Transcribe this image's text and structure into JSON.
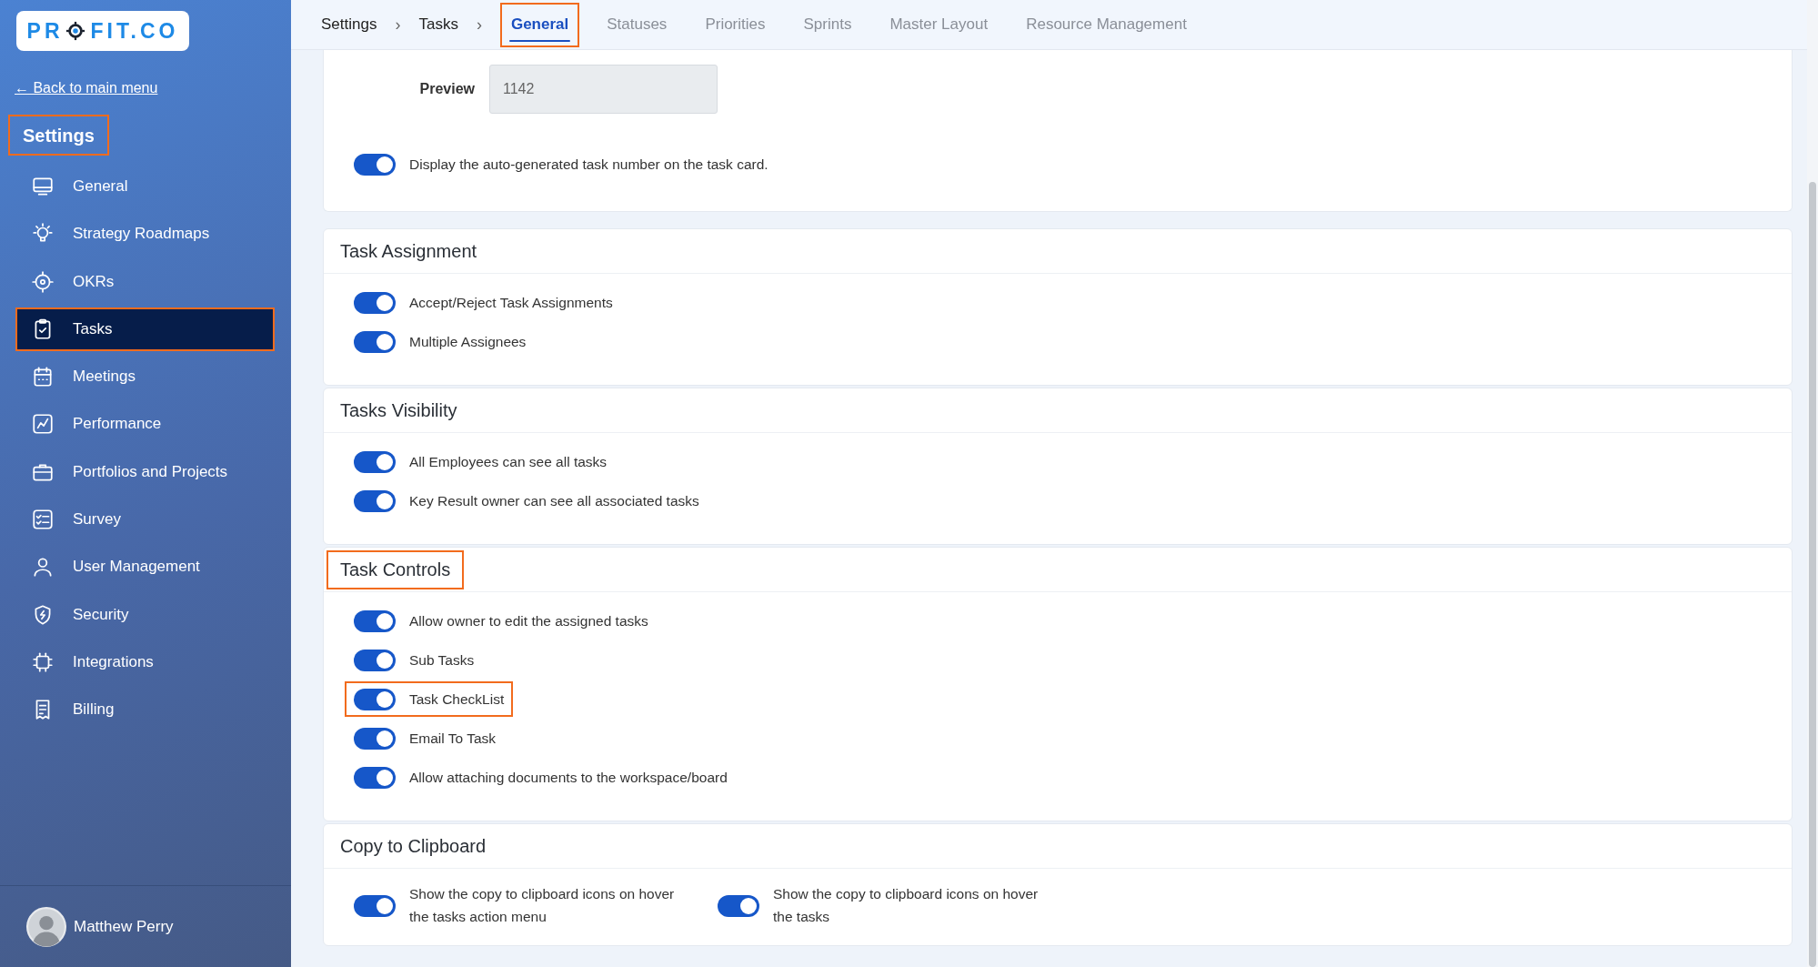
{
  "sidebar": {
    "logo": {
      "before": "PR",
      "after": "FIT.CO"
    },
    "back_link": "← Back to main menu",
    "heading": {
      "text": "Settings",
      "highlighted": true
    },
    "items": [
      {
        "label": "General",
        "selected": false,
        "highlighted": false
      },
      {
        "label": "Strategy Roadmaps",
        "selected": false,
        "highlighted": false
      },
      {
        "label": "OKRs",
        "selected": false,
        "highlighted": false
      },
      {
        "label": "Tasks",
        "selected": true,
        "highlighted": true
      },
      {
        "label": "Meetings",
        "selected": false,
        "highlighted": false
      },
      {
        "label": "Performance",
        "selected": false,
        "highlighted": false
      },
      {
        "label": "Portfolios and Projects",
        "selected": false,
        "highlighted": false
      },
      {
        "label": "Survey",
        "selected": false,
        "highlighted": false
      },
      {
        "label": "User Management",
        "selected": false,
        "highlighted": false
      },
      {
        "label": "Security",
        "selected": false,
        "highlighted": false
      },
      {
        "label": "Integrations",
        "selected": false,
        "highlighted": false
      },
      {
        "label": "Billing",
        "selected": false,
        "highlighted": false
      }
    ],
    "user": {
      "name": "Matthew Perry"
    }
  },
  "breadcrumbs": [
    {
      "label": "Settings",
      "separator": "›"
    },
    {
      "label": "Tasks",
      "separator": "›"
    }
  ],
  "tabs": [
    {
      "label": "General",
      "selected": true,
      "highlighted": true
    },
    {
      "label": "Statuses",
      "selected": false,
      "highlighted": false
    },
    {
      "label": "Priorities",
      "selected": false,
      "highlighted": false
    },
    {
      "label": "Sprints",
      "selected": false,
      "highlighted": false
    },
    {
      "label": "Master Layout",
      "selected": false,
      "highlighted": false
    },
    {
      "label": "Resource Management",
      "selected": false,
      "highlighted": false
    }
  ],
  "task_number": {
    "preview_label": "Preview",
    "preview_value": "1142",
    "settings": [
      {
        "label": "Display the auto-generated task number on the task card.",
        "on": true,
        "highlighted": false
      }
    ]
  },
  "sections": [
    {
      "title": "Task Assignment",
      "highlighted": false,
      "kind": "list",
      "settings": [
        {
          "label": "Accept/Reject Task Assignments",
          "on": true,
          "highlighted": false
        },
        {
          "label": "Multiple Assignees",
          "on": true,
          "highlighted": false
        }
      ]
    },
    {
      "title": "Tasks Visibility",
      "highlighted": false,
      "kind": "list",
      "settings": [
        {
          "label": "All Employees can see all tasks",
          "on": true,
          "highlighted": false
        },
        {
          "label": "Key Result owner can see all associated tasks",
          "on": true,
          "highlighted": false
        }
      ]
    },
    {
      "title": "Task Controls",
      "highlighted": true,
      "kind": "list",
      "settings": [
        {
          "label": "Allow owner to edit the assigned tasks",
          "on": true,
          "highlighted": false
        },
        {
          "label": "Sub Tasks",
          "on": true,
          "highlighted": false
        },
        {
          "label": "Task CheckList",
          "on": true,
          "highlighted": true
        },
        {
          "label": "Email To Task",
          "on": true,
          "highlighted": false
        },
        {
          "label": "Allow attaching documents to the workspace/board",
          "on": true,
          "highlighted": false
        }
      ]
    },
    {
      "title": "Copy to Clipboard",
      "highlighted": false,
      "kind": "columns",
      "settings": [
        {
          "label": "Show the copy to clipboard icons on hover the tasks action menu",
          "on": true,
          "highlighted": false
        },
        {
          "label": "Show the copy to clipboard icons on hover the tasks",
          "on": true,
          "highlighted": false
        }
      ]
    }
  ]
}
